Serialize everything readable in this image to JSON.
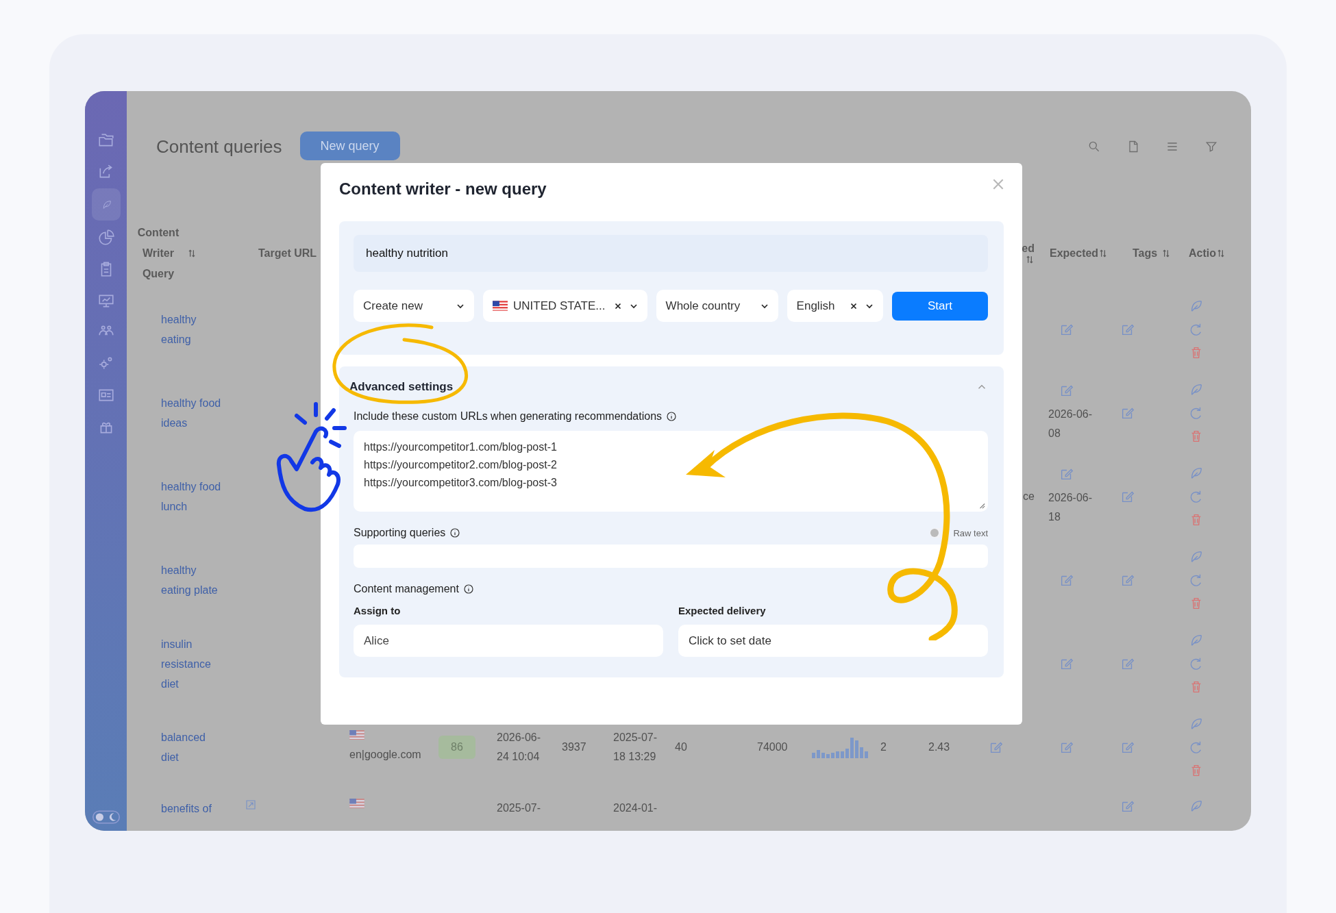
{
  "sidebar": {
    "items": [
      {
        "selected": false
      },
      {
        "selected": false
      },
      {
        "selected": true
      },
      {
        "selected": false
      },
      {
        "selected": false
      },
      {
        "selected": false
      },
      {
        "selected": false
      },
      {
        "selected": false
      },
      {
        "selected": false
      },
      {
        "selected": false
      }
    ]
  },
  "header": {
    "title": "Content queries",
    "new_button": "New query"
  },
  "table": {
    "columns": [
      {
        "label": "Content Writer Query",
        "sortable": true
      },
      {
        "label": "Target URL",
        "sortable": false
      },
      {
        "label": "ed",
        "sortable": true
      },
      {
        "label": "Expected",
        "sortable": true
      },
      {
        "label": "Tags",
        "sortable": true
      },
      {
        "label": "Actio",
        "sortable": true
      }
    ],
    "rows": [
      {
        "query": "healthy eating",
        "expected": {
          "edit": true
        },
        "tags_edit": true,
        "actions": [
          {
            "kind": "write"
          },
          {
            "kind": "rerun"
          },
          {
            "kind": "delete"
          }
        ]
      },
      {
        "query": "healthy food ideas",
        "expected": {
          "edit": true,
          "date": "2026-06-08"
        },
        "tags_edit": true,
        "actions": [
          {
            "kind": "write"
          },
          {
            "kind": "rerun"
          },
          {
            "kind": "delete"
          }
        ]
      },
      {
        "query": "healthy food lunch",
        "column_13": {
          "text": "ce"
        },
        "expected": {
          "edit": true,
          "date": "2026-06-18"
        },
        "tags_edit": true,
        "actions": [
          {
            "kind": "write"
          },
          {
            "kind": "rerun"
          },
          {
            "kind": "delete"
          }
        ]
      },
      {
        "query": "healthy eating plate",
        "expected": {
          "edit": true
        },
        "tags_edit": true,
        "actions": [
          {
            "kind": "write"
          },
          {
            "kind": "rerun"
          },
          {
            "kind": "delete"
          }
        ]
      },
      {
        "query": "insulin resistance diet",
        "expected": {
          "edit": true
        },
        "tags_edit": true,
        "actions": [
          {
            "kind": "write"
          },
          {
            "kind": "rerun"
          },
          {
            "kind": "delete"
          }
        ]
      },
      {
        "query": "balanced diet",
        "cells": [
          {
            "kind": "domain",
            "text": "en|google.com"
          },
          {
            "kind": "score",
            "text": "86"
          },
          {
            "kind": "text",
            "text": "2026-06-24 10:04"
          },
          {
            "kind": "text",
            "text": "3937"
          },
          {
            "kind": "text",
            "text": "2025-07-18 13:29"
          },
          {
            "kind": "text",
            "text": "40"
          },
          {
            "kind": "text",
            "text": "74000"
          },
          {
            "kind": "sparkline"
          },
          {
            "kind": "text",
            "text": "2"
          },
          {
            "kind": "text",
            "text": "2.43"
          }
        ],
        "column_13": {
          "edit": true
        },
        "expected": {
          "edit": true
        },
        "tags_edit": true,
        "actions": [
          {
            "kind": "write"
          },
          {
            "kind": "rerun"
          },
          {
            "kind": "delete"
          }
        ]
      },
      {
        "query": "benefits of",
        "link": true,
        "cut": true,
        "cells": [
          {
            "kind": "flag"
          },
          null,
          {
            "kind": "text",
            "text": "2025-07-"
          },
          null,
          {
            "kind": "text",
            "text": "2024-01-"
          }
        ],
        "tags_edit": true,
        "actions": [
          {
            "kind": "write"
          }
        ]
      }
    ]
  },
  "modal": {
    "title": "Content writer - new query",
    "query": "healthy nutrition",
    "selects": [
      {
        "kind": "plain",
        "value": "Create new",
        "clearable": false
      },
      {
        "kind": "country",
        "value": "UNITED STATE...",
        "clearable": true
      },
      {
        "kind": "plain",
        "value": "Whole country",
        "clearable": false
      },
      {
        "kind": "plain",
        "value": "English",
        "clearable": true
      }
    ],
    "start_button": "Start",
    "advanced": {
      "title": "Advanced settings",
      "expanded": true,
      "urls_label": "Include these custom URLs when generating recommendations",
      "urls": [
        "https://yourcompetitor1.com/blog-post-1",
        "https://yourcompetitor2.com/blog-post-2",
        "https://yourcompetitor3.com/blog-post-3"
      ],
      "supporting_label": "Supporting queries",
      "raw_text": {
        "label": "Raw text",
        "on": false
      },
      "management_label": "Content management",
      "assign": {
        "label": "Assign to",
        "value": "Alice"
      },
      "delivery": {
        "label": "Expected delivery",
        "placeholder": "Click to set date"
      }
    }
  }
}
